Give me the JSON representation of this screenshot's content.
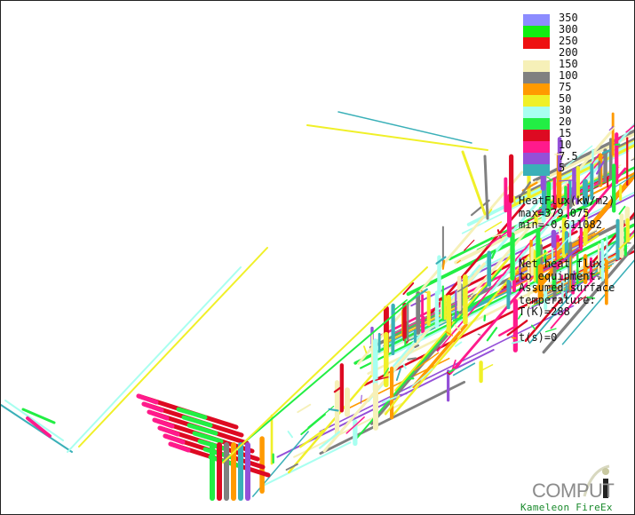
{
  "legend": {
    "items": [
      {
        "value": "350",
        "color": "#8c8cff"
      },
      {
        "value": "300",
        "color": "#11ee11"
      },
      {
        "value": "250",
        "color": "#ee1111"
      },
      {
        "value": "200",
        "color": "#ffffff"
      },
      {
        "value": "150",
        "color": "#f6f0b8"
      },
      {
        "value": "100",
        "color": "#808080"
      },
      {
        "value": "75",
        "color": "#ff9a00"
      },
      {
        "value": "50",
        "color": "#f0f028"
      },
      {
        "value": "30",
        "color": "#a8fff0"
      },
      {
        "value": "20",
        "color": "#22ee44"
      },
      {
        "value": "15",
        "color": "#dd0a22"
      },
      {
        "value": "10",
        "color": "#ff1a8c"
      },
      {
        "value": "7.5",
        "color": "#9450d8"
      },
      {
        "value": "5",
        "color": "#3ab0b8"
      }
    ]
  },
  "info": {
    "heatflux": "HeatFlux(kW/m2)\nmax=379.075\nmin=-0.611082",
    "note": "Net heat flux\nto equipment.\nAssumed surface\ntemperature:\nT(K)=288",
    "time": "t(s)=0"
  },
  "logo": {
    "word": "COMPUT",
    "product": "Kameleon FireEx"
  },
  "palette": {
    "scene": [
      "#3ab0b8",
      "#22ee44",
      "#dd0a22",
      "#ff1a8c",
      "#9450d8",
      "#f0f028",
      "#a8fff0",
      "#808080",
      "#ff9a00",
      "#f6f0b8"
    ]
  }
}
